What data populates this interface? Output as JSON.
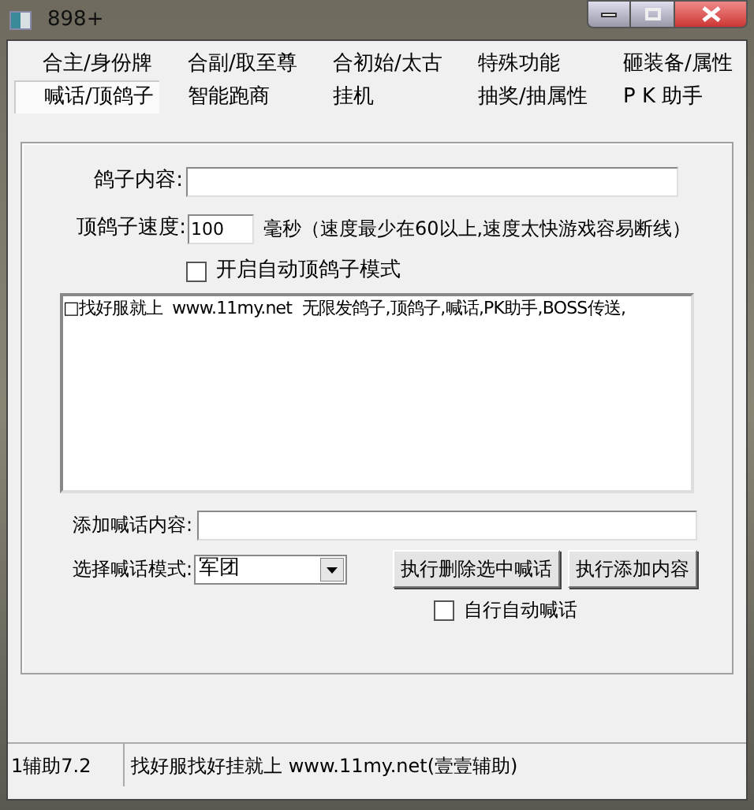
{
  "window": {
    "title": "898+"
  },
  "tabs": [
    {
      "label": "合主/身份牌",
      "selected": false
    },
    {
      "label": "合副/取至尊",
      "selected": false
    },
    {
      "label": "合初始/太古",
      "selected": false
    },
    {
      "label": "特殊功能",
      "selected": false
    },
    {
      "label": "砸装备/属性",
      "selected": false
    },
    {
      "label": "喊话/顶鸽子",
      "selected": true
    },
    {
      "label": "智能跑商",
      "selected": false
    },
    {
      "label": "挂机",
      "selected": false
    },
    {
      "label": "抽奖/抽属性",
      "selected": false
    },
    {
      "label": "P K 助手",
      "selected": false
    }
  ],
  "pigeon_content": {
    "label": "鸽子内容:"
  },
  "speed": {
    "label": "顶鸽子速度:",
    "value": "100",
    "note": "毫秒（速度最少在60以上,速度太快游戏容易断线）"
  },
  "auto_pigeon": {
    "label": "开启自动顶鸽子模式",
    "checked": false
  },
  "messages": [
    {
      "text": "□找好服就上  www.11my.net  无限发鸽子,顶鸽子,喊话,PK助手,BOSS传送,"
    }
  ],
  "add_content": {
    "label": "添加喊话内容:"
  },
  "mode": {
    "label": "选择喊话模式:",
    "value": "军团"
  },
  "buttons": [
    "执行删除选中喊话",
    "执行添加内容"
  ],
  "auto_shout": {
    "label": "自行自动喊话",
    "checked": false
  },
  "status_bar": [
    "1辅助7.2",
    "找好服找好挂就上 www.11my.net(壹壹辅助)"
  ]
}
